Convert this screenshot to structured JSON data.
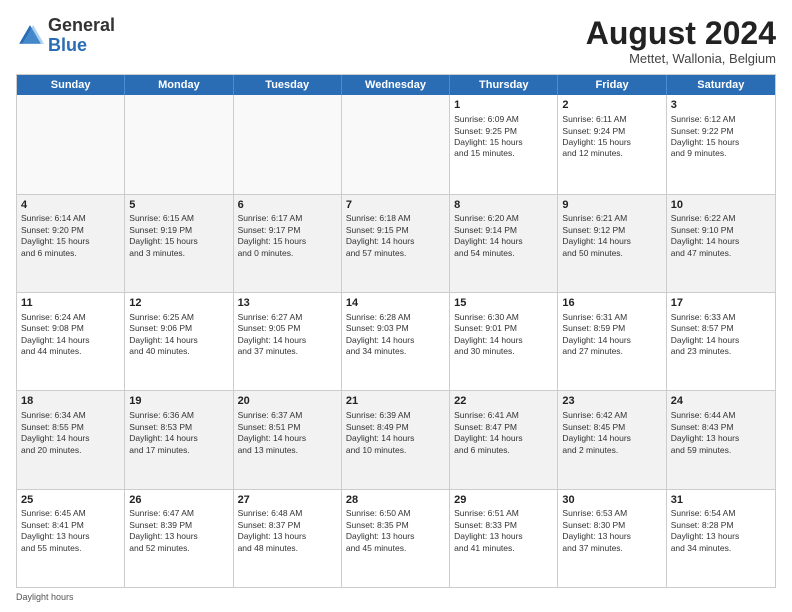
{
  "header": {
    "logo_general": "General",
    "logo_blue": "Blue",
    "title": "August 2024",
    "subtitle": "Mettet, Wallonia, Belgium"
  },
  "days_of_week": [
    "Sunday",
    "Monday",
    "Tuesday",
    "Wednesday",
    "Thursday",
    "Friday",
    "Saturday"
  ],
  "footer": "Daylight hours",
  "weeks": [
    [
      {
        "day": "",
        "info": ""
      },
      {
        "day": "",
        "info": ""
      },
      {
        "day": "",
        "info": ""
      },
      {
        "day": "",
        "info": ""
      },
      {
        "day": "1",
        "info": "Sunrise: 6:09 AM\nSunset: 9:25 PM\nDaylight: 15 hours\nand 15 minutes."
      },
      {
        "day": "2",
        "info": "Sunrise: 6:11 AM\nSunset: 9:24 PM\nDaylight: 15 hours\nand 12 minutes."
      },
      {
        "day": "3",
        "info": "Sunrise: 6:12 AM\nSunset: 9:22 PM\nDaylight: 15 hours\nand 9 minutes."
      }
    ],
    [
      {
        "day": "4",
        "info": "Sunrise: 6:14 AM\nSunset: 9:20 PM\nDaylight: 15 hours\nand 6 minutes."
      },
      {
        "day": "5",
        "info": "Sunrise: 6:15 AM\nSunset: 9:19 PM\nDaylight: 15 hours\nand 3 minutes."
      },
      {
        "day": "6",
        "info": "Sunrise: 6:17 AM\nSunset: 9:17 PM\nDaylight: 15 hours\nand 0 minutes."
      },
      {
        "day": "7",
        "info": "Sunrise: 6:18 AM\nSunset: 9:15 PM\nDaylight: 14 hours\nand 57 minutes."
      },
      {
        "day": "8",
        "info": "Sunrise: 6:20 AM\nSunset: 9:14 PM\nDaylight: 14 hours\nand 54 minutes."
      },
      {
        "day": "9",
        "info": "Sunrise: 6:21 AM\nSunset: 9:12 PM\nDaylight: 14 hours\nand 50 minutes."
      },
      {
        "day": "10",
        "info": "Sunrise: 6:22 AM\nSunset: 9:10 PM\nDaylight: 14 hours\nand 47 minutes."
      }
    ],
    [
      {
        "day": "11",
        "info": "Sunrise: 6:24 AM\nSunset: 9:08 PM\nDaylight: 14 hours\nand 44 minutes."
      },
      {
        "day": "12",
        "info": "Sunrise: 6:25 AM\nSunset: 9:06 PM\nDaylight: 14 hours\nand 40 minutes."
      },
      {
        "day": "13",
        "info": "Sunrise: 6:27 AM\nSunset: 9:05 PM\nDaylight: 14 hours\nand 37 minutes."
      },
      {
        "day": "14",
        "info": "Sunrise: 6:28 AM\nSunset: 9:03 PM\nDaylight: 14 hours\nand 34 minutes."
      },
      {
        "day": "15",
        "info": "Sunrise: 6:30 AM\nSunset: 9:01 PM\nDaylight: 14 hours\nand 30 minutes."
      },
      {
        "day": "16",
        "info": "Sunrise: 6:31 AM\nSunset: 8:59 PM\nDaylight: 14 hours\nand 27 minutes."
      },
      {
        "day": "17",
        "info": "Sunrise: 6:33 AM\nSunset: 8:57 PM\nDaylight: 14 hours\nand 23 minutes."
      }
    ],
    [
      {
        "day": "18",
        "info": "Sunrise: 6:34 AM\nSunset: 8:55 PM\nDaylight: 14 hours\nand 20 minutes."
      },
      {
        "day": "19",
        "info": "Sunrise: 6:36 AM\nSunset: 8:53 PM\nDaylight: 14 hours\nand 17 minutes."
      },
      {
        "day": "20",
        "info": "Sunrise: 6:37 AM\nSunset: 8:51 PM\nDaylight: 14 hours\nand 13 minutes."
      },
      {
        "day": "21",
        "info": "Sunrise: 6:39 AM\nSunset: 8:49 PM\nDaylight: 14 hours\nand 10 minutes."
      },
      {
        "day": "22",
        "info": "Sunrise: 6:41 AM\nSunset: 8:47 PM\nDaylight: 14 hours\nand 6 minutes."
      },
      {
        "day": "23",
        "info": "Sunrise: 6:42 AM\nSunset: 8:45 PM\nDaylight: 14 hours\nand 2 minutes."
      },
      {
        "day": "24",
        "info": "Sunrise: 6:44 AM\nSunset: 8:43 PM\nDaylight: 13 hours\nand 59 minutes."
      }
    ],
    [
      {
        "day": "25",
        "info": "Sunrise: 6:45 AM\nSunset: 8:41 PM\nDaylight: 13 hours\nand 55 minutes."
      },
      {
        "day": "26",
        "info": "Sunrise: 6:47 AM\nSunset: 8:39 PM\nDaylight: 13 hours\nand 52 minutes."
      },
      {
        "day": "27",
        "info": "Sunrise: 6:48 AM\nSunset: 8:37 PM\nDaylight: 13 hours\nand 48 minutes."
      },
      {
        "day": "28",
        "info": "Sunrise: 6:50 AM\nSunset: 8:35 PM\nDaylight: 13 hours\nand 45 minutes."
      },
      {
        "day": "29",
        "info": "Sunrise: 6:51 AM\nSunset: 8:33 PM\nDaylight: 13 hours\nand 41 minutes."
      },
      {
        "day": "30",
        "info": "Sunrise: 6:53 AM\nSunset: 8:30 PM\nDaylight: 13 hours\nand 37 minutes."
      },
      {
        "day": "31",
        "info": "Sunrise: 6:54 AM\nSunset: 8:28 PM\nDaylight: 13 hours\nand 34 minutes."
      }
    ]
  ]
}
